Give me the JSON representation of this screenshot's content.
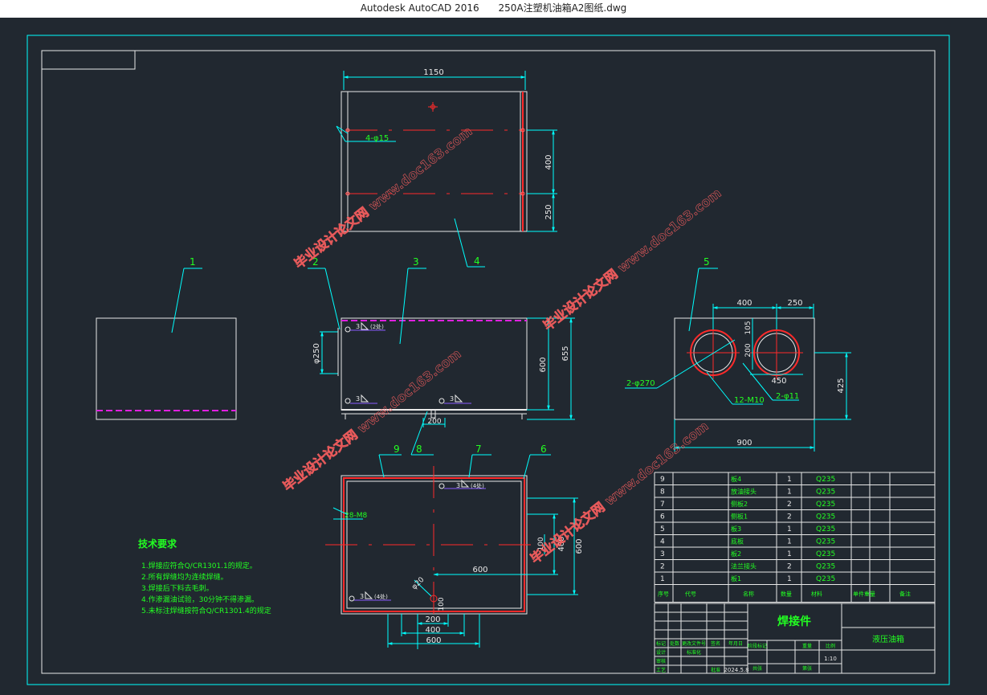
{
  "window": {
    "app_title": "Autodesk AutoCAD 2016",
    "file_title": "250A注塑机油箱A2图纸.dwg"
  },
  "colors": {
    "background": "#212830",
    "white_line": "#e8e8e8",
    "dimension": "#00ffff",
    "green_text": "#22ff22",
    "red_center": "#ff2a2a",
    "magenta": "#e020e0",
    "purple": "#8a5cff",
    "watermark": "#ff6060"
  },
  "top_view": {
    "dim_width": "1150",
    "dim_400": "400",
    "dim_250": "250",
    "hole_note": "4-φ15",
    "balloon": "4"
  },
  "part1": {
    "balloon": "1"
  },
  "front_view": {
    "balloon_2": "2",
    "balloon_3": "3",
    "dim_phi250": "φ250",
    "dim_600": "600",
    "dim_655": "655",
    "dim_200": "200",
    "weld_1": "3",
    "weld_1_qty": "(2处)",
    "weld_2": "3",
    "weld_3": "3"
  },
  "side_view": {
    "balloon": "5",
    "dim_400": "400",
    "dim_250": "250",
    "dim_105": "105",
    "dim_200": "200",
    "dim_450": "450",
    "dim_425": "425",
    "dim_900": "900",
    "note_270": "2-φ270",
    "note_m10": "12-M10",
    "note_11": "2-φ11"
  },
  "bottom_view": {
    "balloon_9": "9",
    "balloon_8": "8",
    "balloon_7": "7",
    "balloon_6": "6",
    "note_m8": "28-M8",
    "weld_a": "3",
    "weld_a_qty": "(4处)",
    "weld_b": "3",
    "weld_b_qty": "(4处)",
    "dim_600_h": "600",
    "dim_400_v": "400",
    "dim_600_v": "600",
    "dim_100_v": "100",
    "dim_phi20": "φ20",
    "dim_100": "100",
    "dim_200": "200",
    "dim_400": "400",
    "dim_600": "600"
  },
  "tech_notes": {
    "title": "技术要求",
    "lines": [
      "1.焊接应符合Q/CR1301.1的规定。",
      "2.所有焊缝均为连续焊缝。",
      "3.焊接后下料去毛刺。",
      "4.作渗漏油试验，30分钟不得渗漏。",
      "5.未标注焊缝按符合Q/CR1301.4的规定"
    ]
  },
  "bom": {
    "rows": [
      {
        "no": "9",
        "name": "板4",
        "qty": "1",
        "mat": "Q235"
      },
      {
        "no": "8",
        "name": "放油接头",
        "qty": "1",
        "mat": "Q235"
      },
      {
        "no": "7",
        "name": "侧板2",
        "qty": "2",
        "mat": "Q235"
      },
      {
        "no": "6",
        "name": "侧板1",
        "qty": "2",
        "mat": "Q235"
      },
      {
        "no": "5",
        "name": "板3",
        "qty": "1",
        "mat": "Q235"
      },
      {
        "no": "4",
        "name": "底板",
        "qty": "1",
        "mat": "Q235"
      },
      {
        "no": "3",
        "name": "板2",
        "qty": "1",
        "mat": "Q235"
      },
      {
        "no": "2",
        "name": "法兰接头",
        "qty": "2",
        "mat": "Q235"
      },
      {
        "no": "1",
        "name": "板1",
        "qty": "1",
        "mat": "Q235"
      }
    ],
    "header": [
      "序号",
      "代号",
      "名称",
      "数量",
      "材料",
      "单件重量",
      "备注"
    ]
  },
  "title_block": {
    "name": "焊接件",
    "drawing": "液压油箱",
    "scale": "1:10",
    "date": "2024.5.8",
    "labels": [
      "标记",
      "处数",
      "分区",
      "更改文件号",
      "签名",
      "年月日",
      "设计",
      "标准化",
      "审核",
      "工艺",
      "批准",
      "阶段标记",
      "重量",
      "比例",
      "共张",
      "第张"
    ]
  },
  "watermark": {
    "text": "毕业设计论文网 www.doc163.com"
  }
}
